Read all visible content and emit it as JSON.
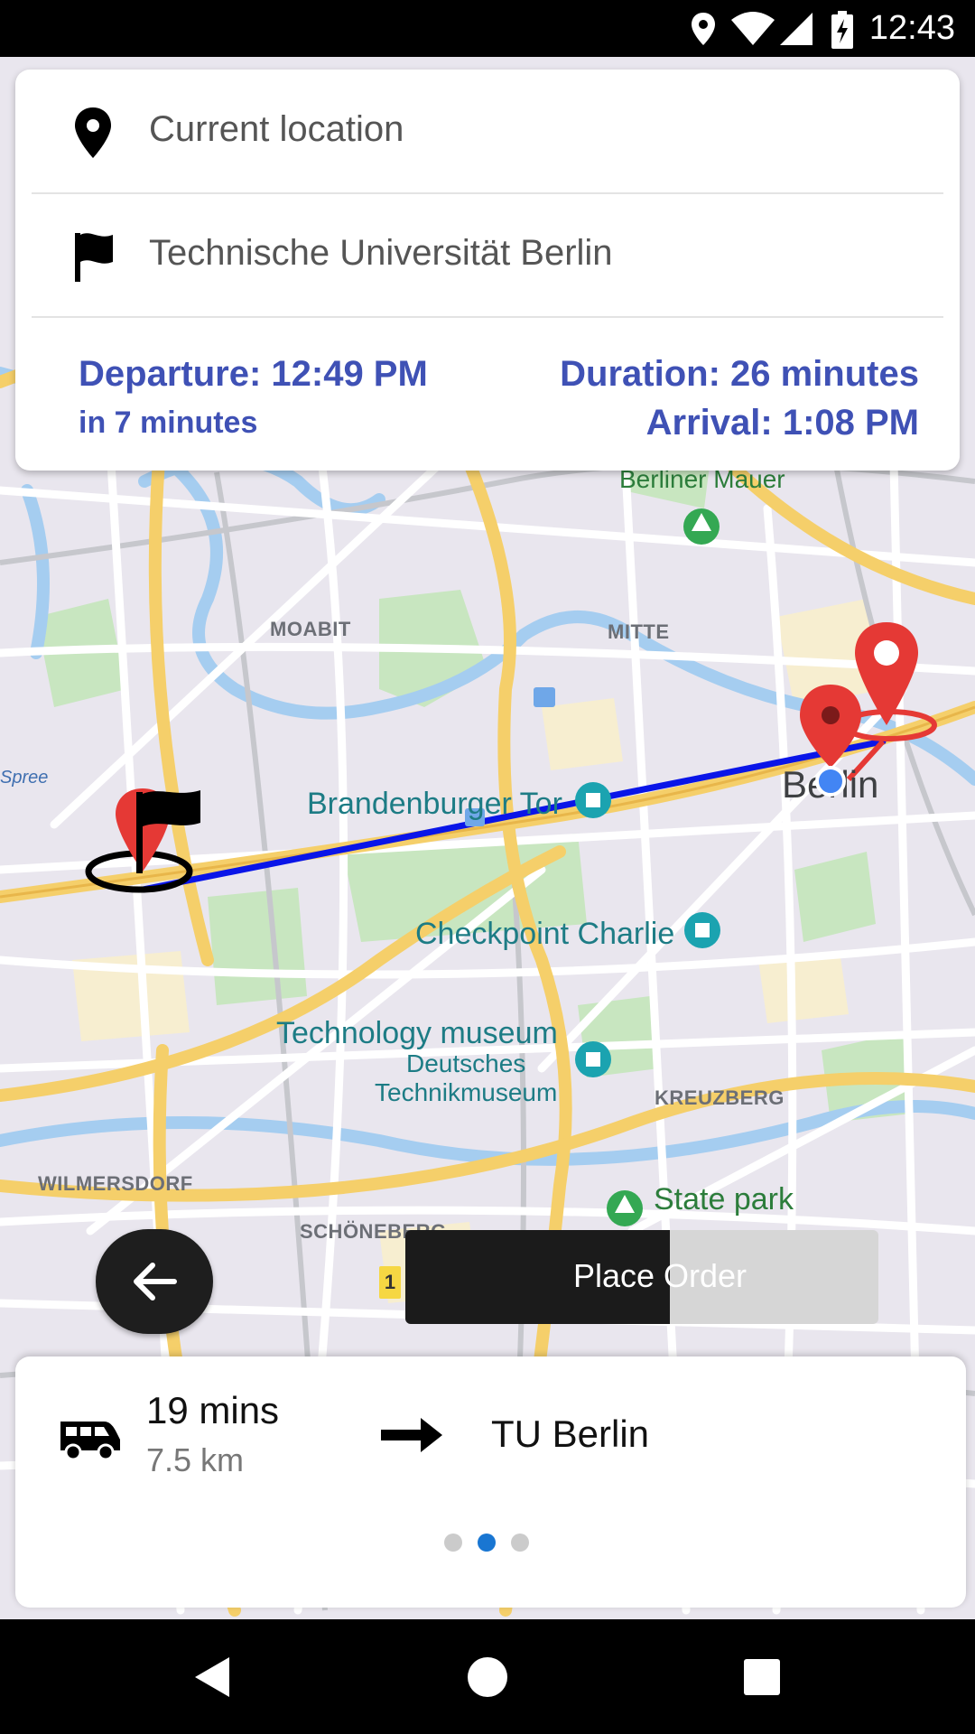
{
  "status_bar": {
    "time": "12:43"
  },
  "route": {
    "origin": "Current location",
    "destination": "Technische Universität Berlin",
    "departure": "Departure: 12:49 PM",
    "departure_in": "in 7 minutes",
    "duration": "Duration: 26 minutes",
    "arrival": "Arrival: 1:08 PM"
  },
  "map": {
    "labels": {
      "berliner_mauer": "Berliner Mauer",
      "moabit": "MOABIT",
      "mitte": "MITTE",
      "spree": "Spree",
      "brandenburger_tor": "Brandenburger Tor",
      "berlin": "Berlin",
      "checkpoint_charlie": "Checkpoint Charlie",
      "technology_museum": "Technology museum",
      "deutsches": "Deutsches",
      "technikmuseum": "Technikmuseum",
      "kreuzberg": "KREUZBERG",
      "wilmersdorf": "WILMERSDORF",
      "schoneberg": "SCHÖNEBERG",
      "state_park": "State park",
      "route_badge": "1"
    },
    "colors": {
      "route": "#0a15e8",
      "marker": "#e53935",
      "location": "#4285f4"
    }
  },
  "controls": {
    "place_order": "Place Order",
    "place_order_progress": 0.56
  },
  "trip": {
    "mins": "19 mins",
    "distance": "7.5 km",
    "destination": "TU Berlin"
  },
  "pager": {
    "count": 3,
    "active": 1
  }
}
